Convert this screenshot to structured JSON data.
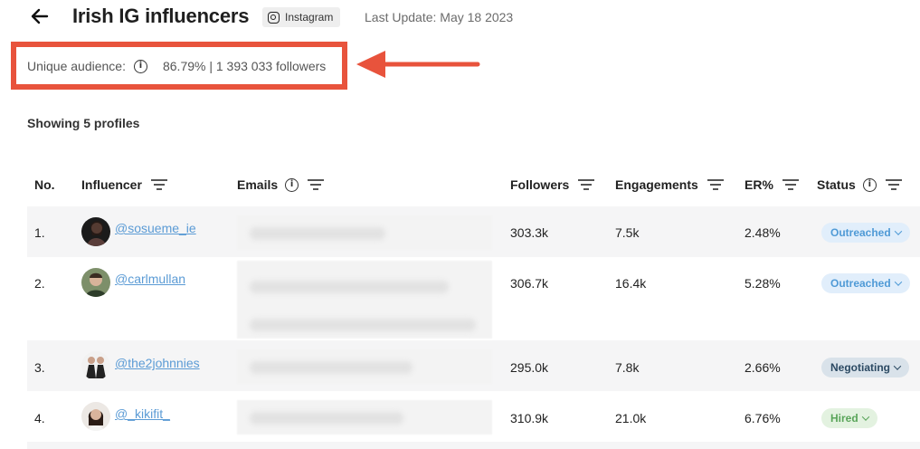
{
  "header": {
    "title": "Irish IG influencers",
    "platform": "Instagram",
    "last_update": "Last Update: May 18 2023"
  },
  "audience": {
    "label": "Unique audience:",
    "value": "86.79% | 1 393 033 followers"
  },
  "showing": "Showing 5 profiles",
  "columns": {
    "no": "No.",
    "influencer": "Influencer",
    "emails": "Emails",
    "followers": "Followers",
    "engagements": "Engagements",
    "er": "ER%",
    "status": "Status"
  },
  "rows": [
    {
      "no": "1.",
      "handle": "@sosueme_ie",
      "followers": "303.3k",
      "engagements": "7.5k",
      "er": "2.48%",
      "status": "Outreached"
    },
    {
      "no": "2.",
      "handle": "@carlmullan",
      "followers": "306.7k",
      "engagements": "16.4k",
      "er": "5.28%",
      "status": "Outreached"
    },
    {
      "no": "3.",
      "handle": "@the2johnnies",
      "followers": "295.0k",
      "engagements": "7.8k",
      "er": "2.66%",
      "status": "Negotiating"
    },
    {
      "no": "4.",
      "handle": "@_kikifit_",
      "followers": "310.9k",
      "engagements": "21.0k",
      "er": "6.76%",
      "status": "Hired"
    }
  ],
  "colors": {
    "highlight": "#e8533c",
    "link": "#5b9bd5",
    "outreached": "#4f9ad6",
    "negotiating": "#2c4a63",
    "hired": "#5aa55a"
  },
  "icons": [
    "back-arrow-icon",
    "instagram-icon",
    "info-icon",
    "filter-icon",
    "chevron-down-icon",
    "annotation-arrow"
  ]
}
